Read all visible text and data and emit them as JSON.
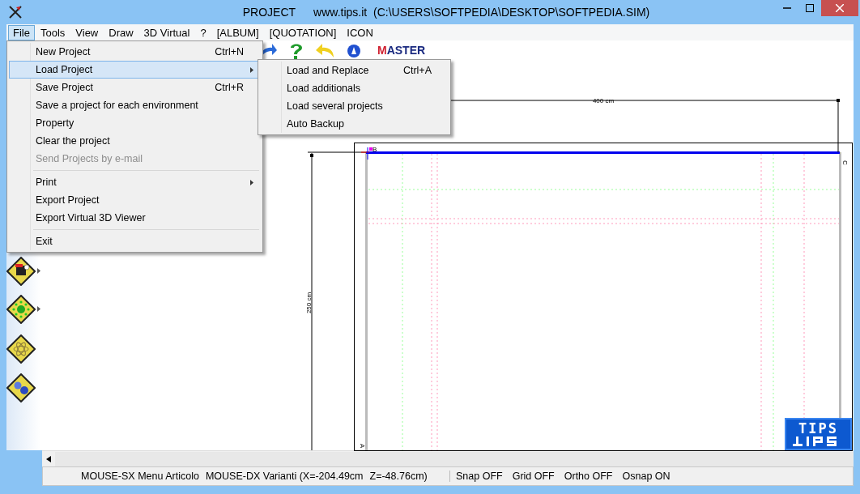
{
  "window": {
    "title": "PROJECT",
    "subtitle": "www.tips.it  (C:\\USERS\\SOFTPEDIA\\DESKTOP\\SOFTPEDIA.SIM)"
  },
  "menubar": [
    {
      "label": "File",
      "selected": true
    },
    {
      "label": "Tools",
      "selected": false
    },
    {
      "label": "View",
      "selected": false
    },
    {
      "label": "Draw",
      "selected": false
    },
    {
      "label": "3D Virtual",
      "selected": false
    },
    {
      "label": "?",
      "selected": false
    },
    {
      "label": "[ALBUM]",
      "selected": false
    },
    {
      "label": "[QUOTATION]",
      "selected": false
    },
    {
      "label": "ICON",
      "selected": false
    }
  ],
  "file_menu": [
    {
      "kind": "item",
      "label": "New Project",
      "shortcut": "Ctrl+N",
      "selected": false,
      "disabled": false,
      "submenu": false
    },
    {
      "kind": "item",
      "label": "Load Project",
      "selected": true,
      "disabled": false,
      "submenu": true
    },
    {
      "kind": "item",
      "label": "Save Project",
      "shortcut": "Ctrl+R",
      "selected": false,
      "disabled": false,
      "submenu": false
    },
    {
      "kind": "item",
      "label": "Save a project for each environment",
      "selected": false,
      "disabled": false,
      "submenu": false
    },
    {
      "kind": "item",
      "label": "Property",
      "selected": false,
      "disabled": false,
      "submenu": false
    },
    {
      "kind": "item",
      "label": "Clear the project",
      "selected": false,
      "disabled": false,
      "submenu": false
    },
    {
      "kind": "item",
      "label": "Send Projects by e-mail",
      "selected": false,
      "disabled": true,
      "submenu": false
    },
    {
      "kind": "separator"
    },
    {
      "kind": "item",
      "label": "Print",
      "selected": false,
      "disabled": false,
      "submenu": true
    },
    {
      "kind": "item",
      "label": "Export Project",
      "selected": false,
      "disabled": false,
      "submenu": false
    },
    {
      "kind": "item",
      "label": "Export Virtual 3D Viewer",
      "selected": false,
      "disabled": false,
      "submenu": false
    },
    {
      "kind": "separator"
    },
    {
      "kind": "item",
      "label": "Exit",
      "selected": false,
      "disabled": false,
      "submenu": false
    }
  ],
  "load_submenu": [
    {
      "label": "Load and Replace",
      "shortcut": "Ctrl+A"
    },
    {
      "label": "Load additionals"
    },
    {
      "label": "Load several projects"
    },
    {
      "label": "Auto Backup"
    }
  ],
  "toolbar": {
    "logo": "MASTER"
  },
  "side_tools": [
    {
      "submenu": true
    },
    {
      "submenu": true
    },
    {
      "submenu": false
    },
    {
      "submenu": false
    }
  ],
  "drawing": {
    "width_label": "400 cm",
    "height_label": "250 cm",
    "corner_labels": [
      "B",
      "C",
      "A"
    ]
  },
  "watermark_logo": "TIPS",
  "status_bar": {
    "mouse_left": "MOUSE-SX Menu Articolo",
    "mouse_right": "MOUSE-DX Varianti (X=-204.49cm",
    "z": "Z=-48.76cm)",
    "toggles": [
      "Snap OFF",
      "Grid OFF",
      "Ortho OFF",
      "Osnap ON"
    ]
  }
}
